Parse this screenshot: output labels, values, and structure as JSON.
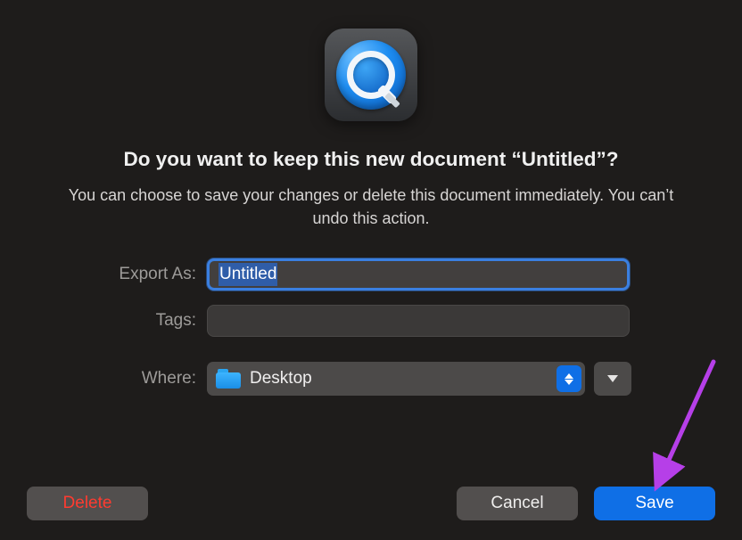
{
  "icon": {
    "name": "quicktime-app-icon"
  },
  "title": "Do you want to keep this new document “Untitled”?",
  "subtitle": "You can choose to save your changes or delete this document immediately. You can’t undo this action.",
  "form": {
    "exportAs": {
      "label": "Export As:",
      "value": "Untitled"
    },
    "tags": {
      "label": "Tags:",
      "value": ""
    },
    "where": {
      "label": "Where:",
      "value": "Desktop",
      "folderIcon": "folder-icon"
    }
  },
  "buttons": {
    "delete": "Delete",
    "cancel": "Cancel",
    "save": "Save"
  },
  "annotation": {
    "arrowColor": "#b63fe8"
  }
}
